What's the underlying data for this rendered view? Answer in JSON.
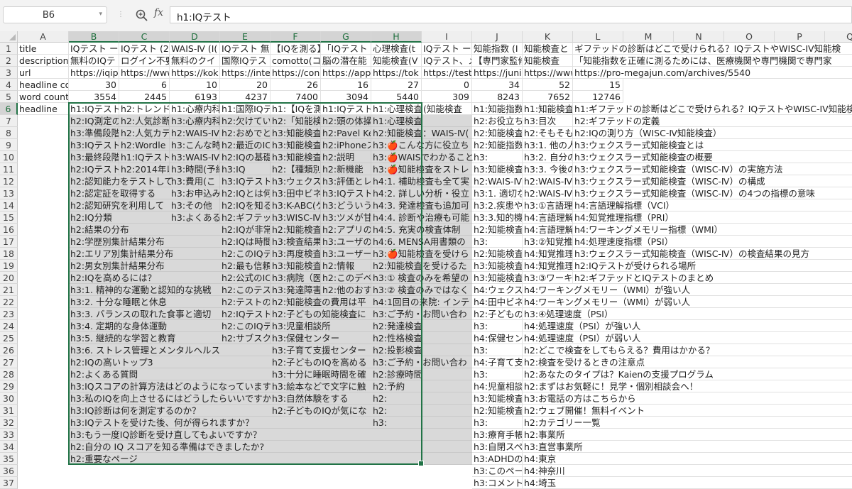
{
  "formula_bar": {
    "name_box": "B6",
    "fx_label": "fx",
    "formula": "h1:IQテスト"
  },
  "columns": [
    "A",
    "B",
    "C",
    "D",
    "E",
    "F",
    "G",
    "H",
    "I",
    "J",
    "K",
    "L",
    "M",
    "N",
    "O",
    "P",
    "Q"
  ],
  "selected_columns": [
    "B",
    "C",
    "D",
    "E",
    "F",
    "G",
    "H"
  ],
  "selected_rows": [
    6
  ],
  "rows": [
    {
      "n": 1,
      "cells": {
        "A": "title",
        "B": "IQテスト ー",
        "C": "IQテスト (20",
        "D": "WAIS-Ⅳ (I(",
        "E": "IQテスト 無",
        "F": "【IQを測る】",
        "G": "「IQテスト 無",
        "H": "心理検査(t",
        "I": "IQテスト ー5",
        "J": "知能指数 (I",
        "K": "知能検査と",
        "L": "ギフテッドの診断はどこで受けられる？IQテストやWISC-IV知能検"
      }
    },
    {
      "n": 2,
      "cells": {
        "A": "description",
        "B": "無料のIQテ",
        "C": "ログイン不要、",
        "D": "無料のクイ",
        "E": "国際IQテス",
        "F": "comotto(コ",
        "G": "脳の潜在能",
        "H": "知能検査(V",
        "I": "IQテスト、メ",
        "J": "【専門家監修】",
        "K": "知能検査",
        "L": "「知能指数を正確に測るためには、医療機関や専門機関で専門家"
      }
    },
    {
      "n": 3,
      "cells": {
        "A": "url",
        "B": "https://iqip",
        "C": "https://www",
        "D": "https://kok",
        "E": "https://inte",
        "F": "https://con",
        "G": "https://app",
        "H": "https://tok",
        "I": "https://test",
        "J": "https://juni",
        "K": "https://www",
        "L": "https://pro-megajun.com/archives/5540"
      }
    },
    {
      "n": 4,
      "cells": {
        "A": "headline co",
        "B": "30",
        "C": "6",
        "D": "10",
        "E": "20",
        "F": "26",
        "G": "16",
        "H": "27",
        "I": "0",
        "J": "34",
        "K": "52",
        "L": "15"
      }
    },
    {
      "n": 5,
      "cells": {
        "A": "word count",
        "B": "3554",
        "C": "2445",
        "D": "6193",
        "E": "4237",
        "F": "7400",
        "G": "3094",
        "H": "5440",
        "I": "309",
        "J": "8243",
        "K": "7652",
        "L": "12746"
      }
    },
    {
      "n": 6,
      "cells": {
        "A": "headline",
        "B": "h1:IQテスト",
        "C": "h2:トレンド",
        "D": "h1:心療内科",
        "E": "h1:国際IQテ",
        "F": "h1:【IQを測",
        "G": "h1:IQテスト",
        "H": "h1:心理検査",
        "I": "(知能検査",
        "J": "h1:知能指数",
        "K": "h1:知能検査",
        "L": "h1:ギフテッドの診断はどこで受けられる？IQテストやWISC-IV知能検"
      }
    },
    {
      "n": 7,
      "cells": {
        "B": "h2:IQ測定の",
        "C": "h2:人気診断",
        "D": "h3:心療内科",
        "E": "h2:欠けてい",
        "F": "h2:「知能検",
        "G": "h2:頭の体操",
        "H": "h1:心理検査",
        "J": "h2:お役立ち",
        "K": "h3:目次",
        "L": "h2:ギフテッドの定義"
      }
    },
    {
      "n": 8,
      "cells": {
        "B": "h3:準備段階",
        "C": "h2:人気カテ",
        "D": "h2:WAIS-Ⅳ",
        "E": "h2:おめでと",
        "F": "h3:知能検査",
        "G": "h2:Pavel Ke",
        "H": "h2:知能検査：WAIS-Ⅳ(",
        "J": "h2:知能検査",
        "K": "h2:そもそも",
        "L": "h2:IQの測り方（WISC-Ⅳ知能検査）"
      }
    },
    {
      "n": 9,
      "cells": {
        "B": "h3:IQテスト",
        "C": "h2:Wordle C",
        "D": "h3:こんな時",
        "E": "h2:最近のIC",
        "F": "h3:知能検査",
        "G": "h2:iPhoneス",
        "H": "h3:🍎こんな方に役立ち",
        "J": "h2:知能指数",
        "K": "h3:1. 他の人",
        "L": "h3:ウェクスラー式知能検査とは"
      }
    },
    {
      "n": 10,
      "cells": {
        "B": "h3:最終段階",
        "C": "h1:IQテスト",
        "D": "h3:WAIS-Ⅳ",
        "E": "h2:IQの基礎",
        "F": "h3:知能検査",
        "G": "h2:説明",
        "H": "h3:🍎WAISでわかること",
        "J": "h3:",
        "K": "h3:2. 自分の",
        "L": "h3:ウェクスラー式知能検査の概要"
      }
    },
    {
      "n": 11,
      "cells": {
        "B": "h2:IQテスト",
        "C": "h2:2014年以",
        "D": "h3:時間(予約",
        "E": "h3:IQ",
        "F": "h2:【種類別】",
        "G": "h2:新機能",
        "H": "h3:🍎知能検査をストレ",
        "J": "h3:知能検査",
        "K": "h3:3. 今後の",
        "L": "h3:ウェクスラー式知能検査（WISC-Ⅳ）の実施方法"
      }
    },
    {
      "n": 12,
      "cells": {
        "B": "h2:認知能力をテストして",
        "D": "h3:費用(こ",
        "E": "h3:IQテスト",
        "F": "h3:ウェクスラー",
        "G": "h3:評価とレ",
        "H": "h4:1. 補助検査も全て実",
        "J": "h2:WAIS-Ⅳ",
        "K": "h2:WAIS-Ⅳ",
        "L": "h3:ウェクスラー式知能検査（WISC-Ⅳ）の構成"
      }
    },
    {
      "n": 13,
      "cells": {
        "B": "h2:認定証を取得する",
        "D": "h3:お申込み",
        "E": "h2:IQとは何",
        "F": "h3:田中ビネー",
        "G": "h3:IQテスト",
        "H": "h4:2. 詳しい分析・役立",
        "J": "h3:1. 適切な",
        "K": "h2:WAIS-Ⅳ",
        "L": "h3:ウェクスラー式知能検査（WISC-Ⅳ）の4つの指標の意味"
      }
    },
    {
      "n": 14,
      "cells": {
        "B": "h2:認知研究を利用して",
        "D": "h3:その他",
        "E": "h2:IQを知る",
        "F": "h3:K-ABC(ケ",
        "G": "h3:どういうナ",
        "H": "h4:3. 発達検査も追加可",
        "J": "h3:2.疾患や",
        "K": "h3:①言語理",
        "L": "h4:言語理解指標（VCI）"
      }
    },
    {
      "n": 15,
      "cells": {
        "B": "h2:IQ分類",
        "D": "h3:よくある",
        "E": "h2:ギフテッド",
        "F": "h3:WISC-Ⅳ",
        "G": "h3:ツメが甘",
        "H": "h4:4. 診断や治療も可能",
        "J": "h3:3.知的機能",
        "K": "h4:言語理解",
        "L": "h4:知覚推理指標（PRI）"
      }
    },
    {
      "n": 16,
      "cells": {
        "B": "h2:結果の分布",
        "E": "h2:IQが非常",
        "F": "h2:知能検査",
        "G": "h2:アプリの",
        "H": "h4:5. 充実の検査体制",
        "J": "h2:知能検査",
        "K": "h4:言語理解",
        "L": "h4:ワーキングメモリー指標（WMI）"
      }
    },
    {
      "n": 17,
      "cells": {
        "B": "h2:学歴別集計結果分布",
        "E": "h2:IQは時間",
        "F": "h3:検査結果の",
        "G": "h3:ユーザのレ",
        "H": "h4:6. MENSA用書類の",
        "J": "h3:",
        "K": "h3:②知覚推",
        "L": "h4:処理速度指標（PSI）"
      }
    },
    {
      "n": 18,
      "cells": {
        "B": "h2:エリア別集計結果分布",
        "E": "h2:このIQテ",
        "F": "h3:再度検査",
        "G": "h3:ユーザー",
        "H": "h3:🍎知能検査を受けら",
        "J": "h2:知能検査",
        "K": "h4:知覚推理",
        "L": "h3:ウェクスラー式知能検査（WISC-Ⅳ）の検査結果の見方"
      }
    },
    {
      "n": 19,
      "cells": {
        "B": "h2:男女別集計結果分布",
        "E": "h2:最も信頼",
        "F": "h3:知能検査",
        "G": "h2:情報",
        "H": "h2:知能検査を受けるた",
        "J": "h3:知能検査",
        "K": "h4:知覚推理",
        "L": "h2:IQテストが受けられる場所"
      }
    },
    {
      "n": 20,
      "cells": {
        "B": "h2:IQを高めるには？",
        "E": "h2:公式のIC",
        "F": "h3:病院（医",
        "G": "h2:このデベロ",
        "H": "h3:① 検査のみを希望の",
        "J": "h3:知能検査",
        "K": "h3:③ワーキ",
        "L": "h2:ギフテッドとIQテストのまとめ"
      }
    },
    {
      "n": 21,
      "cells": {
        "B": "h3:1. 精神的な運動と認知的な挑戦",
        "E": "h2:このテス",
        "F": "h3:発達障害",
        "G": "h2:他のおすす",
        "H": "h3:② 検査のみではなく",
        "J": "h4:ウェクスラ",
        "K": "h4:ワーキングメモリー（WMI）が強い人"
      }
    },
    {
      "n": 22,
      "cells": {
        "B": "h3:2. 十分な睡眠と休息",
        "E": "h2:テストのス",
        "F": "h2:知能検査の費用は平",
        "H": "h4:1回目の来院: インテ",
        "J": "h4:田中ビネ",
        "K": "h4:ワーキングメモリー（WMI）が弱い人"
      }
    },
    {
      "n": 23,
      "cells": {
        "B": "h3:3. バランスの取れた食事と適切",
        "E": "h2:IQテスト",
        "F": "h2:子どもの知能検査に",
        "H": "h3:ご予約・お問い合わ",
        "J": "h2:子どもの",
        "K": "h3:④処理速度（PSI）"
      }
    },
    {
      "n": 24,
      "cells": {
        "B": "h3:4. 定期的な身体運動",
        "E": "h2:このIQテ",
        "F": "h3:児童相談所",
        "H": "h2:発達検査",
        "J": "h3:",
        "K": "h4:処理速度（PSI）が強い人"
      }
    },
    {
      "n": 25,
      "cells": {
        "B": "h3:5. 継続的な学習と教育",
        "E": "h2:サブスク",
        "F": "h3:保健センター",
        "H": "h2:性格検査",
        "J": "h4:保健セン",
        "K": "h4:処理速度（PSI）が弱い人"
      }
    },
    {
      "n": 26,
      "cells": {
        "B": "h3:6. ストレス管理とメンタルヘルス",
        "F": "h3:子育て支援センター",
        "H": "h2:投影検査",
        "J": "h3:",
        "K": "h2:どこで検査をしてもらえる？費用はかかる？"
      }
    },
    {
      "n": 27,
      "cells": {
        "B": "h2:IQの高いトップ3",
        "F": "h2:子どものIQを高める",
        "H": "h3:ご予約・お問い合わ",
        "J": "h4:子育て支",
        "K": "h2:検査を受けるときの注意点"
      }
    },
    {
      "n": 28,
      "cells": {
        "B": "h2:よくある質問",
        "F": "h3:十分に睡眠時間を確",
        "H": "h2:診療時間",
        "J": "h3:",
        "K": "h2:あなたのタイプは？Kaienの支援プログラム"
      }
    },
    {
      "n": 29,
      "cells": {
        "B": "h3:IQスコアの計算方法はどのようになっています",
        "F": "h3:絵本などで文字に触",
        "H": "h2:予約",
        "J": "h4:児童相談",
        "K": "h2:まずはお気軽に！見学・個別相談会へ！"
      }
    },
    {
      "n": 30,
      "cells": {
        "B": "h3:私のIQを向上させるにはどうしたらいいですか",
        "F": "h3:自然体験をする",
        "H": "h2:",
        "J": "h3:知能検査",
        "K": "h3:お電話の方はこちらから"
      }
    },
    {
      "n": 31,
      "cells": {
        "B": "h3:IQ診断は何を測定するのか？",
        "F": "h2:子どものIQが気にな",
        "H": "h2:",
        "J": "h2:知能検査",
        "K": "h2:ウェブ開催！無料イベント"
      }
    },
    {
      "n": 32,
      "cells": {
        "B": "h3:IQテストを受けた後、何が得られますか？",
        "H": "h3:",
        "J": "h3:",
        "K": "h2:カテゴリー一覧"
      }
    },
    {
      "n": 33,
      "cells": {
        "B": "h3:もう一度IQ診断を受け直してもよいですか？",
        "J": "h3:療育手帳",
        "K": "h2:事業所"
      }
    },
    {
      "n": 34,
      "cells": {
        "B": "h2:自分の IQ スコアを知る準備はできましたか?",
        "J": "h3:自閉スペ",
        "K": "h3:直営事業所"
      }
    },
    {
      "n": 35,
      "cells": {
        "B": "h2:重要なページ",
        "J": "h3:ADHDの",
        "K": "h4:東京"
      }
    },
    {
      "n": 36,
      "cells": {
        "J": "h3:このペー",
        "K": "h4:神奈川"
      }
    },
    {
      "n": 37,
      "cells": {
        "J": "h3:コメント",
        "K": "h4:埼玉"
      }
    }
  ]
}
